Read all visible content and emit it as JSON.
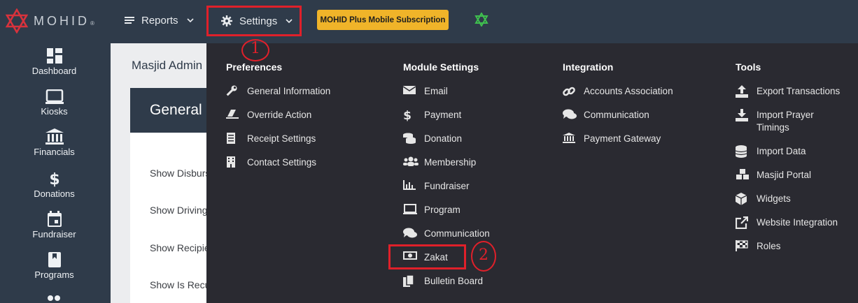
{
  "brand": {
    "name": "MOHID",
    "reg": "®"
  },
  "topnav": {
    "reports_label": "Reports",
    "settings_label": "Settings",
    "subscription_label": "MOHID Plus Mobile Subscription"
  },
  "sidebar": {
    "items": [
      {
        "label": "Dashboard",
        "icon": "dashboard-icon"
      },
      {
        "label": "Kiosks",
        "icon": "kiosk-icon"
      },
      {
        "label": "Financials",
        "icon": "bank-icon"
      },
      {
        "label": "Donations",
        "icon": "dollar-icon"
      },
      {
        "label": "Fundraiser",
        "icon": "calendar-icon"
      },
      {
        "label": "Programs",
        "icon": "book-icon"
      }
    ]
  },
  "page": {
    "breadcrumb": "Masjid Admin",
    "card_title": "General S",
    "rows": [
      "Show Disbursement",
      "Show Driving",
      "Show Recipient",
      "Show Is Recurring"
    ]
  },
  "menu": {
    "preferences": {
      "title": "Preferences",
      "items": [
        "General Information",
        "Override Action",
        "Receipt Settings",
        "Contact Settings"
      ]
    },
    "module_settings": {
      "title": "Module Settings",
      "items": [
        "Email",
        "Payment",
        "Donation",
        "Membership",
        "Fundraiser",
        "Program",
        "Communication",
        "Zakat",
        "Bulletin Board"
      ]
    },
    "integration": {
      "title": "Integration",
      "items": [
        "Accounts Association",
        "Communication",
        "Payment Gateway"
      ]
    },
    "tools": {
      "title": "Tools",
      "items": [
        "Export Transactions",
        "Import Prayer Timings",
        "Import Data",
        "Masjid Portal",
        "Widgets",
        "Website Integration",
        "Roles"
      ]
    }
  },
  "annotations": {
    "step1": "1",
    "step2": "2"
  },
  "colors": {
    "topbar": "#2f3b4a",
    "menu_bg": "#2a2a31",
    "accent": "#f0b429",
    "highlight": "#e0202a"
  }
}
